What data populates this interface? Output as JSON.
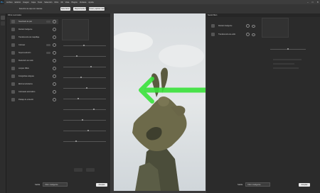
{
  "app": {
    "logo": "Ps"
  },
  "menu": [
    "Archivo",
    "Edición",
    "Imagen",
    "Capa",
    "Texto",
    "Selección",
    "Filtro",
    "3D",
    "Vista",
    "Plugins",
    "Ventana",
    "Ayuda"
  ],
  "options_bar": {
    "button1": "Selección de capa con máscara",
    "button2": "Seleccionar",
    "button3": "Mejorar borde",
    "button4": "Seleccionar y aplicar máscara..."
  },
  "left_panel": {
    "title": "Filtros neuronales",
    "items": [
      {
        "label": "Suavizado de piel",
        "selected": true,
        "badge": true
      },
      {
        "label": "Retrato inteligente",
        "selected": false,
        "badge": false
      },
      {
        "label": "Transferencia de maquillaje",
        "selected": false,
        "badge": false
      },
      {
        "label": "Colorear",
        "selected": false,
        "badge": true
      },
      {
        "label": "Superresolución",
        "selected": false,
        "badge": true
      },
      {
        "label": "Reducción de ruido",
        "selected": false,
        "badge": false
      },
      {
        "label": "Limpiar JPEG",
        "selected": false,
        "badge": false
      },
      {
        "label": "Fotografías antiguas",
        "selected": false,
        "badge": false
      },
      {
        "label": "Eliminar artefactos",
        "selected": false,
        "badge": false
      },
      {
        "label": "Coloreado automático",
        "selected": false,
        "badge": false
      },
      {
        "label": "Paisaje de ensueño",
        "selected": false,
        "badge": false
      }
    ],
    "output_label": "Salida",
    "output_value": "Filtro inteligente",
    "ok_label": "Aceptar"
  },
  "right_panel": {
    "title": "Neural filters",
    "items": [
      {
        "label": "Retrato inteligente"
      },
      {
        "label": "Transferencia de estilo"
      }
    ],
    "output_label": "Salida",
    "output_value": "Filtro inteligente",
    "ok_label": "Aceptar"
  },
  "colors": {
    "accent": "#31a8ff",
    "arrow": "#39e23a",
    "sky": "#d7dde1"
  },
  "icons": [
    "close-icon",
    "minimize-icon",
    "maximize-icon",
    "eye-icon",
    "toggle-icon"
  ]
}
